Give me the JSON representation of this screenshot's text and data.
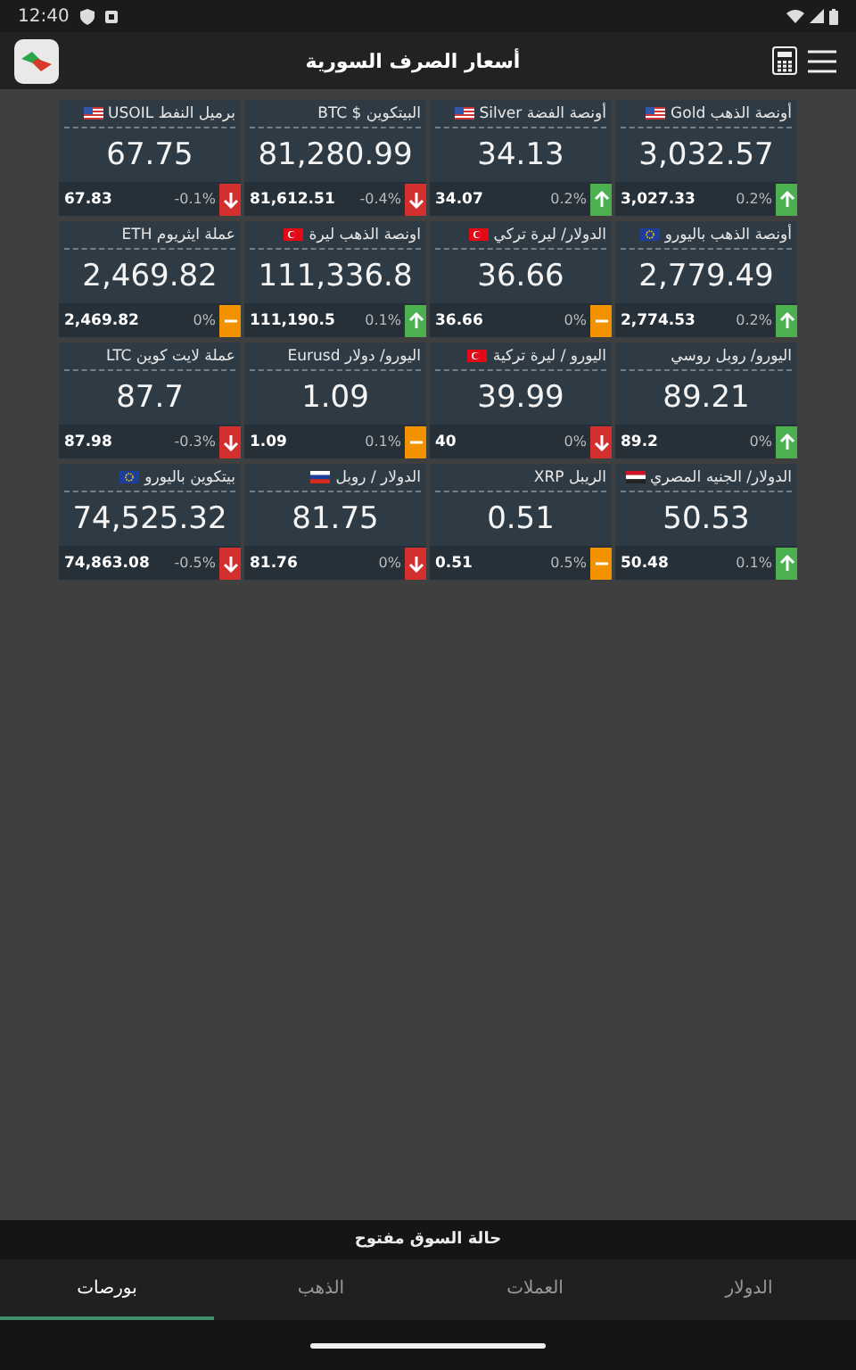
{
  "status_bar": {
    "time": "12:40"
  },
  "app_bar": {
    "title": "أسعار الصرف السورية"
  },
  "cards": [
    {
      "title": "أونصة الذهب Gold",
      "flag": {
        "kind": "us"
      },
      "price": "3,032.57",
      "change": "0.2%",
      "trend": {
        "kind": "up"
      },
      "previous": "3,027.33"
    },
    {
      "title": "أونصة الفضة  Silver",
      "flag": {
        "kind": "us"
      },
      "price": "34.13",
      "change": "0.2%",
      "trend": {
        "kind": "up"
      },
      "previous": "34.07"
    },
    {
      "title": "البيتكوين $ BTC",
      "price": "81,280.99",
      "change": "-0.4%",
      "trend": {
        "kind": "down"
      },
      "previous": "81,612.51"
    },
    {
      "title": "برميل النفط USOIL",
      "flag": {
        "kind": "us"
      },
      "price": "67.75",
      "change": "-0.1%",
      "trend": {
        "kind": "down"
      },
      "previous": "67.83"
    },
    {
      "title": "أونصة الذهب باليورو",
      "flag": {
        "kind": "eu"
      },
      "price": "2,779.49",
      "change": "0.2%",
      "trend": {
        "kind": "up"
      },
      "previous": "2,774.53"
    },
    {
      "title": "الدولار/ ليرة تركي",
      "flag": {
        "kind": "tr"
      },
      "price": "36.66",
      "change": "0%",
      "trend": {
        "kind": "flat"
      },
      "previous": "36.66"
    },
    {
      "title": "اونصة الذهب ليرة",
      "flag": {
        "kind": "tr"
      },
      "price": "111,336.8",
      "change": "0.1%",
      "trend": {
        "kind": "up"
      },
      "previous": "111,190.5"
    },
    {
      "title": "عملة ايثريوم  ETH",
      "price": "2,469.82",
      "change": "0%",
      "trend": {
        "kind": "flat"
      },
      "previous": "2,469.82"
    },
    {
      "title": "اليورو/ روبل روسي",
      "price": "89.21",
      "change": "0%",
      "trend": {
        "kind": "up"
      },
      "previous": "89.2"
    },
    {
      "title": "اليورو / ليرة تركية",
      "flag": {
        "kind": "tr"
      },
      "price": "39.99",
      "change": "0%",
      "trend": {
        "kind": "down"
      },
      "previous": "40"
    },
    {
      "title": "اليورو/ دولار    Eurusd",
      "price": "1.09",
      "change": "0.1%",
      "trend": {
        "kind": "flat"
      },
      "previous": "1.09"
    },
    {
      "title": "عملة لايت كوين LTC",
      "price": "87.7",
      "change": "-0.3%",
      "trend": {
        "kind": "down"
      },
      "previous": "87.98"
    },
    {
      "title": "الدولار/ الجنيه المصري",
      "flag": {
        "kind": "eg"
      },
      "price": "50.53",
      "change": "0.1%",
      "trend": {
        "kind": "up"
      },
      "previous": "50.48"
    },
    {
      "title": "الريبل    XRP",
      "price": "0.51",
      "change": "0.5%",
      "trend": {
        "kind": "flat"
      },
      "previous": "0.51"
    },
    {
      "title": "الدولار / روبل",
      "flag": {
        "kind": "ru"
      },
      "price": "81.75",
      "change": "0%",
      "trend": {
        "kind": "down"
      },
      "previous": "81.76"
    },
    {
      "title": "بيتكوين باليورو",
      "flag": {
        "kind": "eu"
      },
      "price": "74,525.32",
      "change": "-0.5%",
      "trend": {
        "kind": "down"
      },
      "previous": "74,863.08"
    }
  ],
  "market_status": "حالة السوق مفتوح",
  "tabs": [
    {
      "label": "الدولار",
      "selected": false
    },
    {
      "label": "العملات",
      "selected": false
    },
    {
      "label": "الذهب",
      "selected": false
    },
    {
      "label": "بورصات",
      "selected": true
    }
  ]
}
